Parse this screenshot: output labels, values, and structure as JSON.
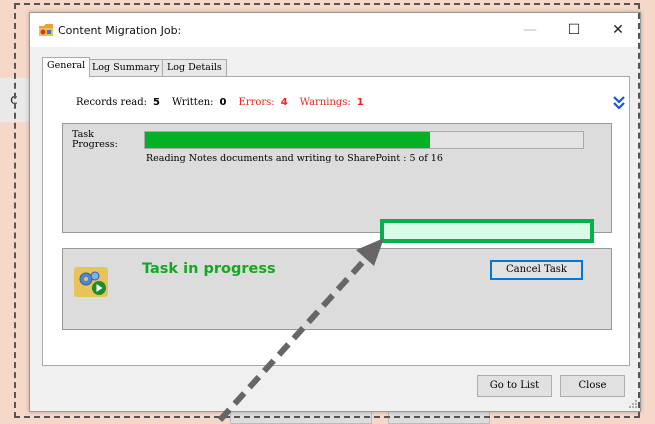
{
  "window": {
    "title": "Content Migration Job:",
    "minimize_glyph": "—",
    "maximize_glyph": "☐",
    "close_glyph": "✕"
  },
  "background": {
    "fragment_glyph": "c"
  },
  "tabs": [
    {
      "label": "General",
      "active": true
    },
    {
      "label": "Log Summary",
      "active": false
    },
    {
      "label": "Log Details",
      "active": false
    }
  ],
  "stats": {
    "records_read_label": "Records read:",
    "records_read_value": "5",
    "written_label": "Written:",
    "written_value": "0",
    "errors_label": "Errors:",
    "errors_value": "4",
    "warnings_label": "Warnings:",
    "warnings_value": "1"
  },
  "progress": {
    "label_line1": "Task",
    "label_line2": "Progress:",
    "percent": 65,
    "status_text": "Reading Notes documents and writing to SharePoint : 5 of 16"
  },
  "task": {
    "status": "Task in progress",
    "cancel_button": "Cancel Task"
  },
  "footer": {
    "go_to_list_button": "Go to List",
    "close_button": "Close"
  },
  "colors": {
    "progress_green": "#06b025",
    "status_green": "#14a821",
    "error_red": "#e8261b",
    "highlight_border": "#06b04c",
    "highlight_fill": "#d8fce8",
    "page_background": "#f6d8c8"
  },
  "icons": {
    "app": "folder-app-icon",
    "expand": "double-chevron-down-icon",
    "status": "gears-play-icon",
    "grip": "resize-grip-icon"
  }
}
